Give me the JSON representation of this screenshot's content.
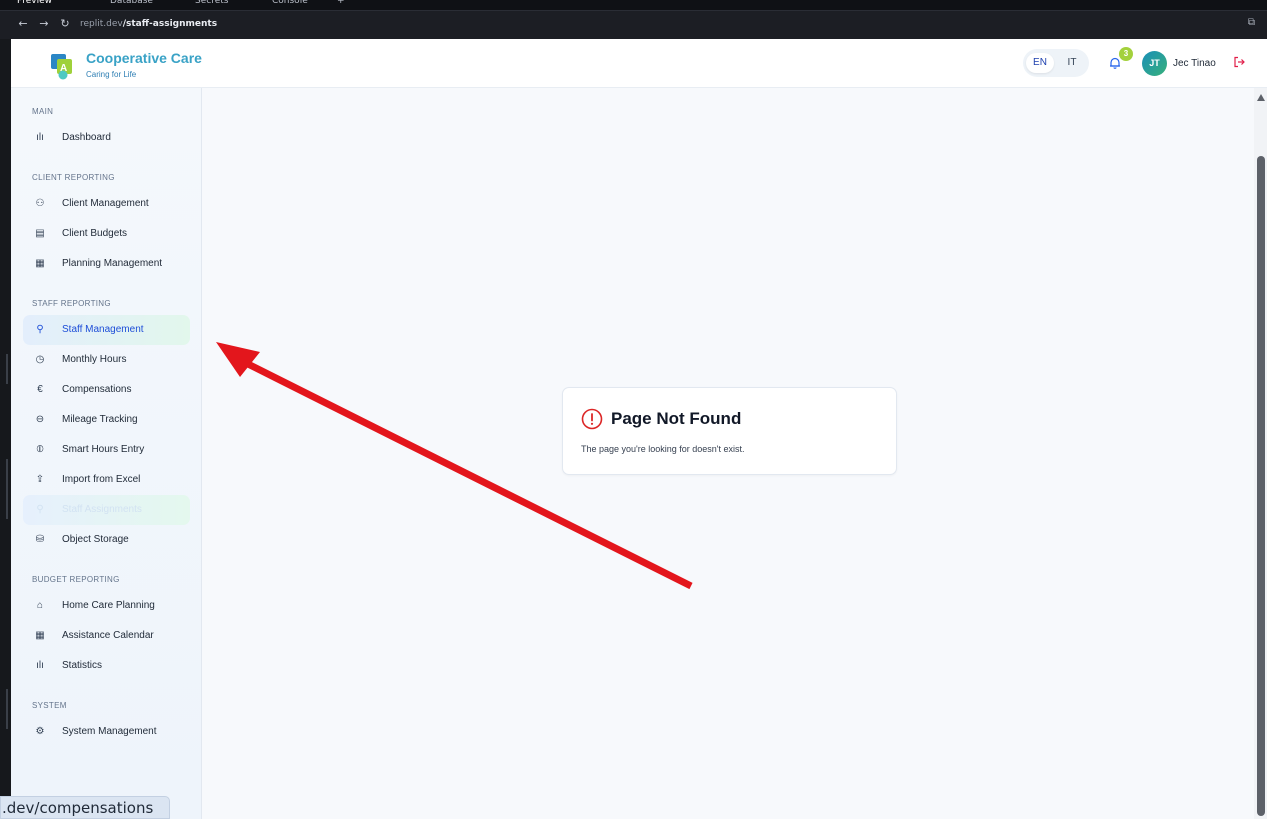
{
  "browser": {
    "tabs": [
      "Preview",
      "Database",
      "Secrets",
      "Console"
    ],
    "new_tab": "+",
    "url_host": "replit.dev",
    "url_path": "/staff-assignments",
    "status_url": ".dev/compensations"
  },
  "header": {
    "brand_title": "Cooperative Care",
    "brand_subtitle": "Caring for Life",
    "lang_en": "EN",
    "lang_it": "IT",
    "notification_count": "3",
    "user_initials": "JT",
    "user_name": "Jec Tinao"
  },
  "sidebar": {
    "sections": [
      {
        "label": "MAIN"
      },
      {
        "label": "CLIENT REPORTING"
      },
      {
        "label": "STAFF REPORTING"
      },
      {
        "label": "BUDGET REPORTING"
      },
      {
        "label": "SYSTEM"
      }
    ],
    "items": [
      {
        "label": "Dashboard",
        "icon": "bar-chart-icon"
      },
      {
        "label": "Client Management",
        "icon": "users-icon"
      },
      {
        "label": "Client Budgets",
        "icon": "budget-icon"
      },
      {
        "label": "Planning Management",
        "icon": "calendar-icon"
      },
      {
        "label": "Staff Management",
        "icon": "user-check-icon"
      },
      {
        "label": "Monthly Hours",
        "icon": "clock-icon"
      },
      {
        "label": "Compensations",
        "icon": "euro-icon"
      },
      {
        "label": "Mileage Tracking",
        "icon": "car-icon"
      },
      {
        "label": "Smart Hours Entry",
        "icon": "smart-icon"
      },
      {
        "label": "Import from Excel",
        "icon": "upload-icon"
      },
      {
        "label": "Staff Assignments",
        "icon": "assign-icon"
      },
      {
        "label": "Object Storage",
        "icon": "database-icon"
      },
      {
        "label": "Home Care Planning",
        "icon": "home-icon"
      },
      {
        "label": "Assistance Calendar",
        "icon": "calendar-icon"
      },
      {
        "label": "Statistics",
        "icon": "bar-chart-icon"
      },
      {
        "label": "System Management",
        "icon": "gear-icon"
      }
    ]
  },
  "main": {
    "error_title": "Page Not Found",
    "error_message": "The page you're looking for doesn't exist."
  },
  "colors": {
    "brand": "#39a2c6",
    "active_text": "#1d4ed8",
    "arrow": "#e3161c",
    "badge": "#a3d13c"
  }
}
